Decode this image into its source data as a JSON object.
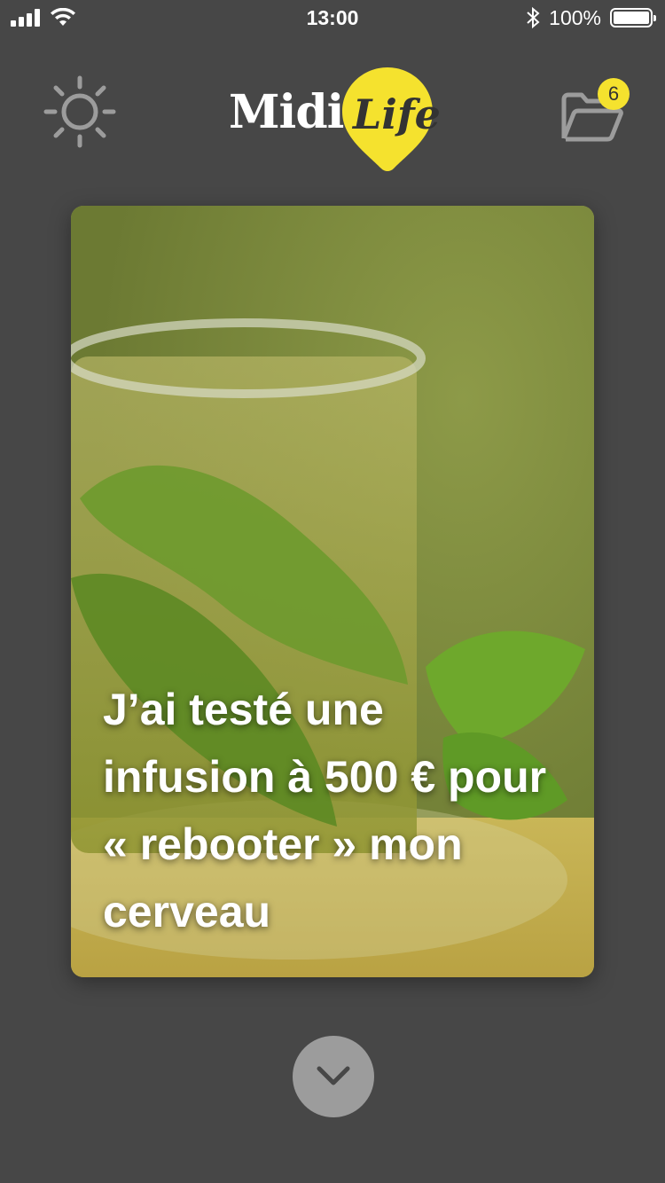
{
  "status_bar": {
    "time": "13:00",
    "battery_percent": "100%",
    "battery_level": 1.0,
    "signal_icon": "cellular-signal-icon",
    "wifi_icon": "wifi-icon",
    "bluetooth_icon": "bluetooth-icon"
  },
  "header": {
    "settings_icon": "sun-icon",
    "logo": {
      "midi": "Midi",
      "life": "Life",
      "accent_color": "#f5e22e"
    },
    "folder_icon": "folder-open-icon",
    "folder_badge_count": "6"
  },
  "card": {
    "title": "J’ai testé une infusion à 500 € pour « rebooter » mon cerveau"
  },
  "navigation": {
    "down_icon": "chevron-down-icon"
  },
  "colors": {
    "background": "#474747",
    "accent": "#f5e22e",
    "icon_gray": "#9c9c9c"
  }
}
